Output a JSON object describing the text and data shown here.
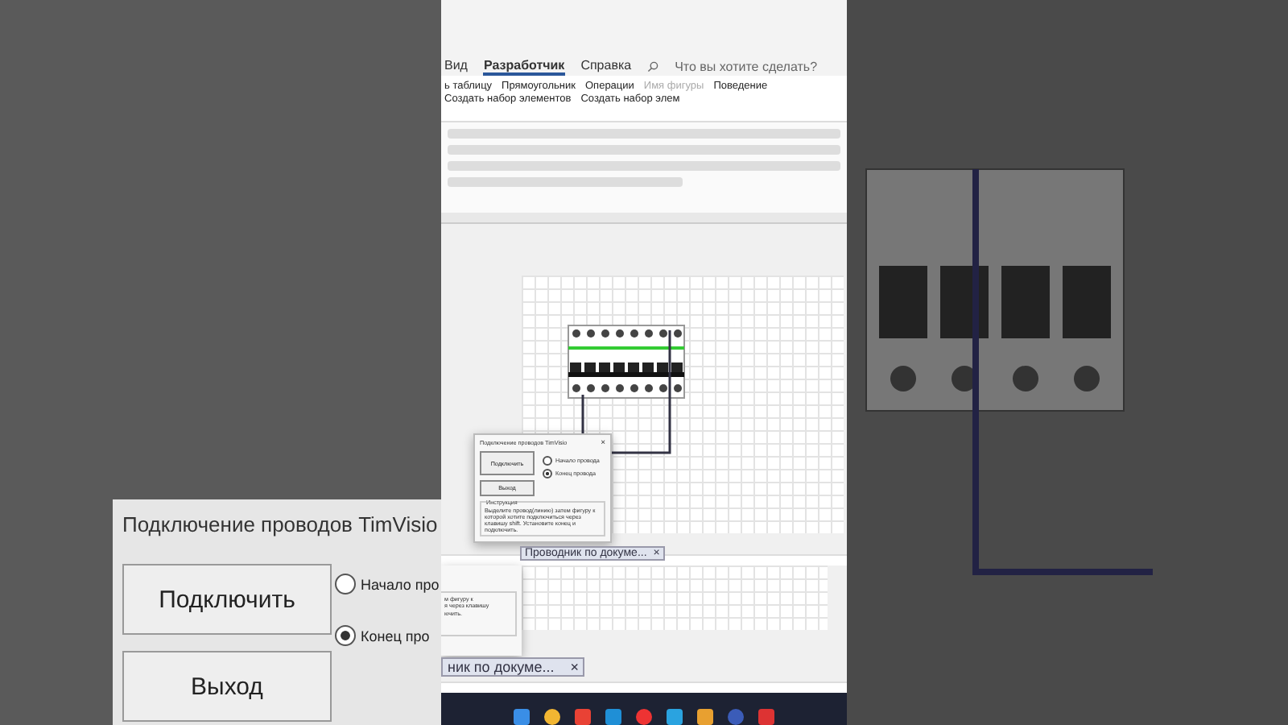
{
  "background_left": {
    "dialog_title": "Подключение проводов TimVisio",
    "buttons": [
      "Подключить",
      "Выход"
    ],
    "options": [
      {
        "label": "Начало про",
        "selected": false
      },
      {
        "label": "Конец про",
        "selected": true
      }
    ]
  },
  "ribbon": {
    "tabs": [
      {
        "label": "Вид",
        "selected": false
      },
      {
        "label": "Разработчик",
        "selected": true
      },
      {
        "label": "Справка",
        "selected": false
      }
    ],
    "search": {
      "placeholder": "Что вы хотите сделать?"
    },
    "commands": [
      {
        "label": "ь таблицу",
        "disabled": false
      },
      {
        "label": "Прямоугольник",
        "disabled": false
      },
      {
        "label": "Операции",
        "disabled": false
      },
      {
        "label": "Имя фигуры",
        "disabled": true
      },
      {
        "label": "Поведение",
        "disabled": false
      },
      {
        "label": "Создать набор элементов",
        "disabled": false
      },
      {
        "label": "Создать набор элем",
        "disabled": false
      }
    ]
  },
  "dialog": {
    "title": "Подключение проводов TimVisio",
    "close": "×",
    "buttons": [
      "Подключить",
      "Выход"
    ],
    "options": [
      {
        "label": "Начало провода",
        "selected": false
      },
      {
        "label": "Конец провода",
        "selected": true
      }
    ],
    "group_title": "Инструкция",
    "instructions": "Выделите провод(линию) затем фигуру к которой хотите подключиться через клавишу shift. Установите конец и подключить."
  },
  "doc_tab": {
    "label": "Проводник по докуме...",
    "close": "×"
  },
  "zoomed": {
    "instruction_lines": [
      "м фигуру к",
      "я через клавишу",
      "ючить."
    ],
    "doc_tab": "ник по докуме...",
    "close": "×"
  }
}
